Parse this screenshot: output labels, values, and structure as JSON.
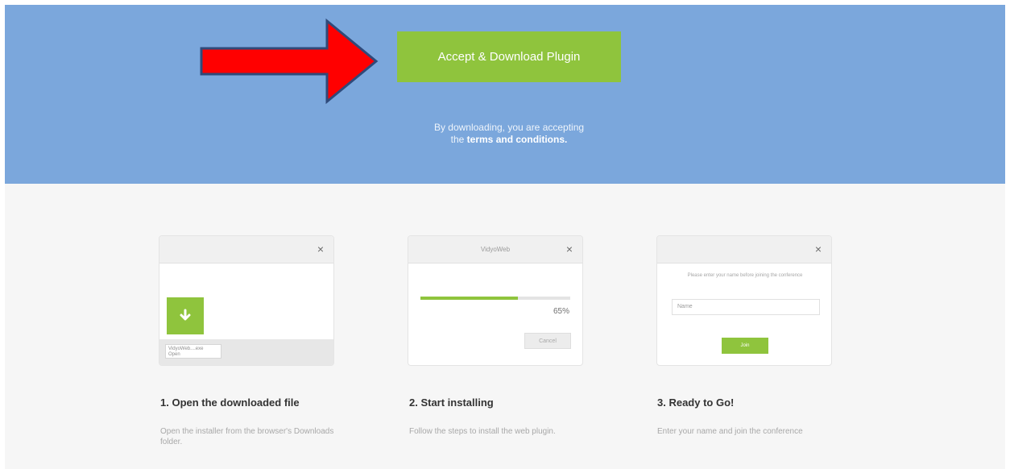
{
  "hero": {
    "download_label": "Accept & Download Plugin",
    "terms_line1": "By downloading, you are accepting",
    "terms_prefix": "the",
    "terms_link": "terms and conditions."
  },
  "steps": [
    {
      "title": "1. Open the downloaded file",
      "description": "Open the installer from the browser's Downloads folder.",
      "illustration": {
        "close_glyph": "×",
        "file_label": "VidyoWeb....exe",
        "file_sub": "Open"
      }
    },
    {
      "title": "2. Start installing",
      "description": "Follow the steps to install the web plugin.",
      "illustration": {
        "window_title": "VidyoWeb",
        "close_glyph": "×",
        "progress_percent": 65,
        "progress_label": "65%",
        "cancel_label": "Cancel"
      }
    },
    {
      "title": "3. Ready to Go!",
      "description": "Enter your name and join the conference",
      "illustration": {
        "close_glyph": "×",
        "prompt": "Please enter your name before joining the conference",
        "name_placeholder": "Name",
        "join_label": "Join"
      }
    }
  ],
  "colors": {
    "hero_bg": "#7ba7dc",
    "accent_green": "#8fc43d",
    "annotation_arrow_fill": "#ff0000",
    "annotation_arrow_stroke": "#2f4a7a"
  },
  "icons": {
    "download_tile": "arrow-down-icon",
    "close": "close-icon"
  }
}
